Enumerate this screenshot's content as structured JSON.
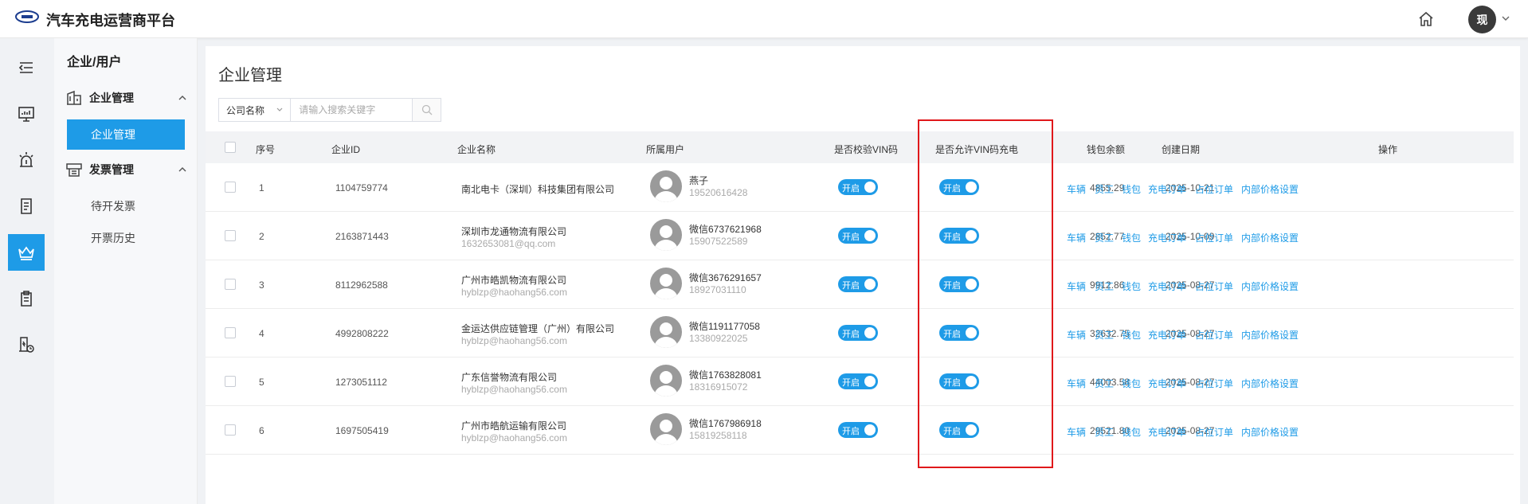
{
  "app": {
    "title": "汽车充电运营商平台",
    "user_initial": "现"
  },
  "sidebar": {
    "icons": [
      "collapse-icon",
      "monitor-icon",
      "alarm-icon",
      "document-icon",
      "crown-icon",
      "clipboard-icon",
      "charging-icon"
    ],
    "active_index": 4
  },
  "submenu": {
    "title": "企业/用户",
    "groups": [
      {
        "label": "企业管理",
        "items": [
          "企业管理"
        ]
      },
      {
        "label": "发票管理",
        "items": [
          "待开发票",
          "开票历史"
        ]
      }
    ]
  },
  "page": {
    "title": "企业管理"
  },
  "search": {
    "field": "公司名称",
    "placeholder": "请输入搜索关键字"
  },
  "table": {
    "headers": {
      "index": "序号",
      "company_id": "企业ID",
      "company_name": "企业名称",
      "user": "所属用户",
      "verify_vin": "是否校验VIN码",
      "allow_vin": "是否允许VIN码充电",
      "balance": "钱包余额",
      "created": "创建日期",
      "ops": "操作"
    },
    "toggle_label": "开启",
    "ops": [
      "车辆",
      "员工",
      "钱包",
      "充电订单",
      "占位订单",
      "内部价格设置"
    ],
    "rows": [
      {
        "index": "1",
        "id": "1104759774",
        "name": "南北电卡（深圳）科技集团有限公司",
        "email": "",
        "user": "燕子",
        "phone": "19520616428",
        "verify": true,
        "allow": true,
        "balance": "4855.29",
        "date": "2025-10-21"
      },
      {
        "index": "2",
        "id": "2163871443",
        "name": "深圳市龙通物流有限公司",
        "email": "1632653081@qq.com",
        "user": "微信6737621968",
        "phone": "15907522589",
        "verify": true,
        "allow": true,
        "balance": "2852.77",
        "date": "2025-10-09"
      },
      {
        "index": "3",
        "id": "8112962588",
        "name": "广州市皓凯物流有限公司",
        "email": "hyblzp@haohang56.com",
        "user": "微信3676291657",
        "phone": "18927031110",
        "verify": true,
        "allow": true,
        "balance": "9912.86",
        "date": "2025-08-27"
      },
      {
        "index": "4",
        "id": "4992808222",
        "name": "金运达供应链管理（广州）有限公司",
        "email": "hyblzp@haohang56.com",
        "user": "微信1191177058",
        "phone": "13380922025",
        "verify": true,
        "allow": true,
        "balance": "32632.75",
        "date": "2025-08-27"
      },
      {
        "index": "5",
        "id": "1273051112",
        "name": "广东信誉物流有限公司",
        "email": "hyblzp@haohang56.com",
        "user": "微信1763828081",
        "phone": "18316915072",
        "verify": true,
        "allow": true,
        "balance": "44003.58",
        "date": "2025-08-27"
      },
      {
        "index": "6",
        "id": "1697505419",
        "name": "广州市皓航运输有限公司",
        "email": "hyblzp@haohang56.com",
        "user": "微信1767986918",
        "phone": "15819258118",
        "verify": true,
        "allow": true,
        "balance": "29521.80",
        "date": "2025-08-27"
      }
    ]
  },
  "colors": {
    "accent": "#1e9be7",
    "highlight": "#e0181b"
  }
}
